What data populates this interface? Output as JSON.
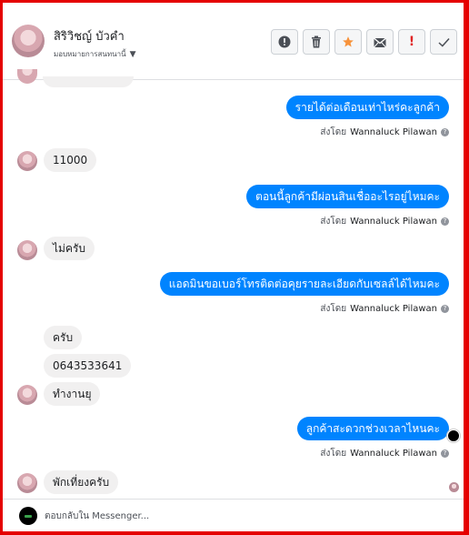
{
  "header": {
    "contact_name": "สิริวิชญ์ บัวคำ",
    "assign_label": "มอบหมายการสนทนานี้",
    "toolbar": {
      "info_icon": "!",
      "trash_icon": "🗑",
      "star_icon": "★",
      "mail_icon": "✉",
      "spam_icon": "!",
      "check_icon": "✓"
    },
    "colors": {
      "star": "#f7923a",
      "spam": "#e02424"
    }
  },
  "messages": [
    {
      "side": "out",
      "text": "รายได้ต่อเดือนเท่าไหร่คะลูกค้า",
      "sent_by_prefix": "ส่งโดย",
      "sent_by_name": "Wannaluck Pilawan"
    },
    {
      "side": "in",
      "text": "11000"
    },
    {
      "side": "out",
      "text": "ตอนนี้ลูกค้ามีผ่อนสินเชื่ออะไรอยู่ไหมคะ",
      "sent_by_prefix": "ส่งโดย",
      "sent_by_name": "Wannaluck Pilawan"
    },
    {
      "side": "in",
      "text": "ไม่ครับ"
    },
    {
      "side": "out",
      "text": "แอดมินขอเบอร์โทรติดต่อคุยรายละเอียดกับเซลล์ได้ไหมคะ",
      "sent_by_prefix": "ส่งโดย",
      "sent_by_name": "Wannaluck Pilawan"
    },
    {
      "side": "in",
      "text": "ครับ"
    },
    {
      "side": "in",
      "text": "0643533641"
    },
    {
      "side": "in",
      "text": "ทำงานยุ"
    },
    {
      "side": "out",
      "text": "ลูกค้าสะดวกช่วงเวลาไหนคะ",
      "sent_by_prefix": "ส่งโดย",
      "sent_by_name": "Wannaluck Pilawan"
    },
    {
      "side": "in",
      "text": "พักเที่ยงครับ"
    }
  ],
  "composer": {
    "placeholder": "ตอบกลับใน Messenger..."
  },
  "colors": {
    "frame_border": "#e50000",
    "outgoing_bubble": "#0084ff",
    "incoming_bubble": "#f1f0f0"
  }
}
